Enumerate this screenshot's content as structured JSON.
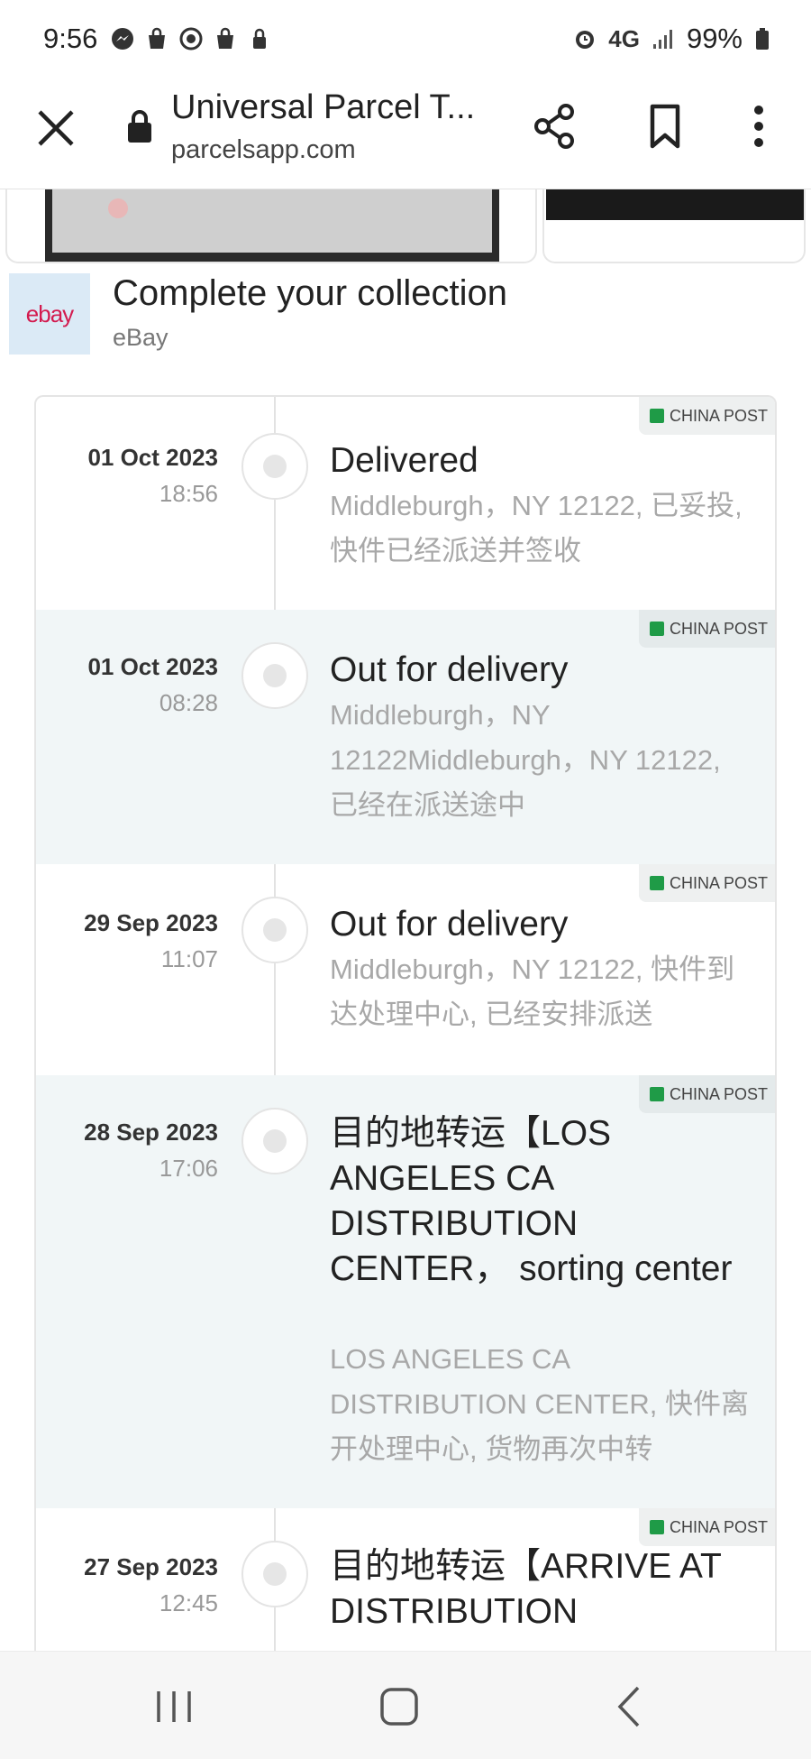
{
  "status_bar": {
    "time": "9:56",
    "network": "4G",
    "battery": "99%",
    "icons_left": [
      "messenger-icon",
      "shopping-bag-icon",
      "sync-icon",
      "shopping-bag-icon",
      "lock-icon"
    ],
    "icons_right": [
      "alarm-icon",
      "network-4g-icon",
      "signal-icon",
      "battery-icon"
    ]
  },
  "browser": {
    "title": "Universal Parcel T...",
    "url": "parcelsapp.com"
  },
  "ad": {
    "logo_text": "ebay",
    "title": "Complete your collection",
    "subtitle": "eBay"
  },
  "events": [
    {
      "date": "01 Oct 2023",
      "time": "18:56",
      "carrier": "CHINA POST",
      "title": "Delivered",
      "desc": "Middleburgh，NY 12122, 已妥投, 快件已经派送并签收"
    },
    {
      "date": "01 Oct 2023",
      "time": "08:28",
      "carrier": "CHINA POST",
      "title": "Out for delivery",
      "desc": "Middleburgh，NY 12122Middleburgh，NY 12122, 已经在派送途中"
    },
    {
      "date": "29 Sep 2023",
      "time": "11:07",
      "carrier": "CHINA POST",
      "title": "Out for delivery",
      "desc": "Middleburgh，NY 12122, 快件到达处理中心, 已经安排派送"
    },
    {
      "date": "28 Sep 2023",
      "time": "17:06",
      "carrier": "CHINA POST",
      "title": "目的地转运【LOS ANGELES CA DISTRIBUTION CENTER， sorting center",
      "desc": "LOS ANGELES CA DISTRIBUTION CENTER, 快件离开处理中心, 货物再次中转"
    },
    {
      "date": "27 Sep 2023",
      "time": "12:45",
      "carrier": "CHINA POST",
      "title": "目的地转运【ARRIVE AT DISTRIBUTION",
      "desc": ""
    }
  ],
  "colors": {
    "shaded_row": "#f1f6f7",
    "muted_text": "#a8a8a8",
    "ebay_red": "#d31b4f",
    "china_post_green": "#1f9b47"
  }
}
